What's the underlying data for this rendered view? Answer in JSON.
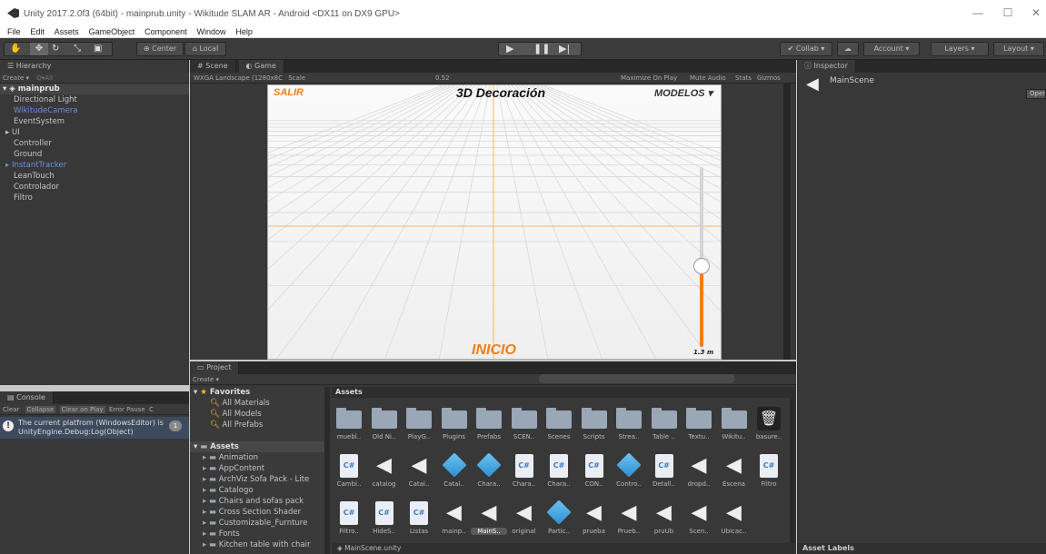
{
  "window": {
    "title": "Unity 2017.2.0f3 (64bit) - mainprub.unity - Wikitude SLAM AR - Android <DX11 on DX9 GPU>"
  },
  "menu": [
    "File",
    "Edit",
    "Assets",
    "GameObject",
    "Component",
    "Window",
    "Help"
  ],
  "toolbar": {
    "center": "Center",
    "local": "Local",
    "collab": "Collab",
    "account": "Account",
    "layers": "Layers",
    "layout": "Layout"
  },
  "hierarchy": {
    "tab": "Hierarchy",
    "create": "Create",
    "search": "Q▾All",
    "root": "mainprub",
    "items": [
      {
        "label": "Directional Light",
        "blue": false,
        "fold": false
      },
      {
        "label": "WikitudeCamera",
        "blue": true,
        "fold": false
      },
      {
        "label": "EventSystem",
        "blue": false,
        "fold": false
      },
      {
        "label": "UI",
        "blue": false,
        "fold": true
      },
      {
        "label": "Controller",
        "blue": false,
        "fold": false
      },
      {
        "label": "Ground",
        "blue": false,
        "fold": false
      },
      {
        "label": "InstantTracker",
        "blue": true,
        "fold": true
      },
      {
        "label": "LeanTouch",
        "blue": false,
        "fold": false
      },
      {
        "label": "Controlador",
        "blue": false,
        "fold": false
      },
      {
        "label": "Filtro",
        "blue": false,
        "fold": false
      }
    ]
  },
  "center": {
    "scene_tab": "Scene",
    "game_tab": "Game",
    "resolution": "WXGA Landscape (1280x8C",
    "scale_label": "Scale",
    "scale_value": "0.52",
    "buttons": [
      "Maximize On Play",
      "Mute Audio",
      "Stats",
      "Gizmos"
    ]
  },
  "game": {
    "salir": "SALIR",
    "title": "3D Decoración",
    "modelos": "MODELOS",
    "inicio": "INICIO",
    "height": "1.3 m",
    "slider_level": 0.45
  },
  "inspector": {
    "tab": "Inspector",
    "object": "MainScene",
    "open": "Open",
    "asset_labels": "Asset Labels"
  },
  "console": {
    "tab": "Console",
    "buttons": [
      "Clear",
      "Collapse",
      "Clear on Play",
      "Error Pause",
      "C"
    ],
    "message_line1": "The current platfrom (WindowsEditor) is",
    "message_line2": "UnityEngine.Debug:Log(Object)",
    "count": "1"
  },
  "project": {
    "tab": "Project",
    "create": "Create",
    "favorites": "Favorites",
    "favorite_items": [
      "All Materials",
      "All Models",
      "All Prefabs"
    ],
    "assets_root": "Assets",
    "asset_folders": [
      "Animation",
      "AppContent",
      "ArchViz Sofa Pack - Lite",
      "Catalogo",
      "Chairs and sofas pack",
      "Cross Section Shader",
      "Customizable_Furnture",
      "Fonts",
      "Kitchen table with chair"
    ],
    "breadcrumb": "Assets",
    "footer": "MainScene.unity",
    "row1": [
      "muebl..",
      "Old Ni..",
      "PlayG..",
      "Plugins",
      "Prefabs",
      "SCEN..",
      "Scenes",
      "Scripts",
      "Strea..",
      "Table ..",
      "Textu..",
      "Wikitu..",
      "basure.."
    ],
    "row2": [
      "Cambi..",
      "catalog",
      "Catal..",
      "Catal..",
      "Chara..",
      "Chara..",
      "Chara..",
      "CON..",
      "Contro..",
      "Detall..",
      "dropd..",
      "Escena",
      "Filtro"
    ],
    "row3": [
      "Filtro..",
      "HideS..",
      "Listas",
      "mainp..",
      "MainS..",
      "original",
      "Partic..",
      "prueba",
      "Prueb..",
      "pruUb",
      "Scen..",
      "Ubicac.."
    ]
  }
}
